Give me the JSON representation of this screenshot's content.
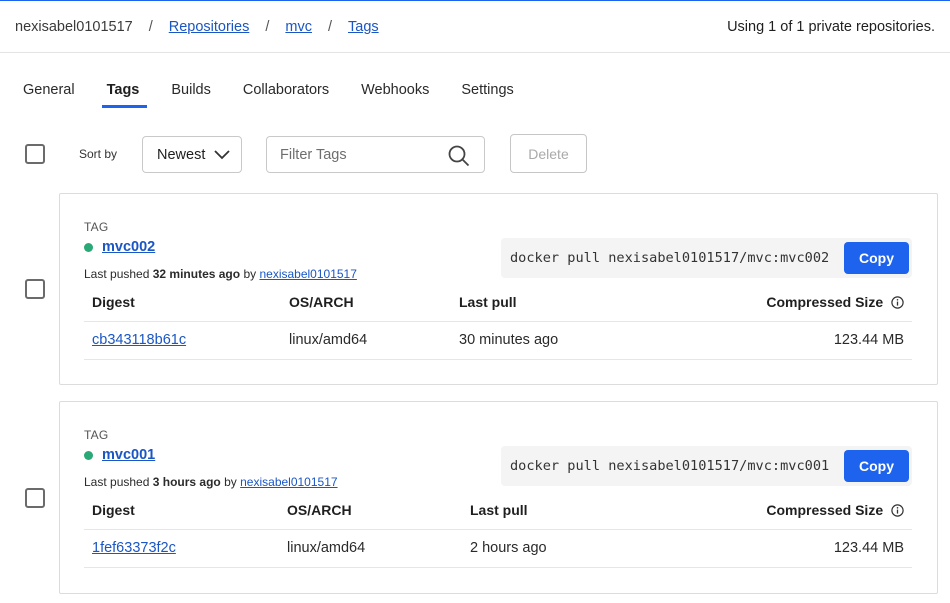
{
  "breadcrumb": {
    "user": "nexisabel0101517",
    "sep": "/",
    "repositories": "Repositories",
    "repo": "mvc",
    "tags": "Tags"
  },
  "usage_text": "Using 1 of 1 private repositories.",
  "tabs": [
    {
      "label": "General"
    },
    {
      "label": "Tags",
      "active": true
    },
    {
      "label": "Builds"
    },
    {
      "label": "Collaborators"
    },
    {
      "label": "Webhooks"
    },
    {
      "label": "Settings"
    }
  ],
  "toolbar": {
    "sort_label": "Sort by",
    "sort_value": "Newest",
    "filter_placeholder": "Filter Tags",
    "delete_label": "Delete"
  },
  "columns": {
    "digest": "Digest",
    "os_arch": "OS/ARCH",
    "last_pull": "Last pull",
    "size": "Compressed Size"
  },
  "tags": [
    {
      "section_label": "TAG",
      "name": "mvc002",
      "pushed_prefix": "Last pushed",
      "pushed_time": "32 minutes ago",
      "pushed_by": "by",
      "pusher": "nexisabel0101517",
      "pull_command": "docker pull nexisabel0101517/mvc:mvc002",
      "copy_label": "Copy",
      "digest": "cb343118b61c",
      "os_arch": "linux/amd64",
      "last_pull": "30 minutes ago",
      "size": "123.44 MB"
    },
    {
      "section_label": "TAG",
      "name": "mvc001",
      "pushed_prefix": "Last pushed",
      "pushed_time": "3 hours ago",
      "pushed_by": "by",
      "pusher": "nexisabel0101517",
      "pull_command": "docker pull nexisabel0101517/mvc:mvc001",
      "copy_label": "Copy",
      "digest": "1fef63373f2c",
      "os_arch": "linux/amd64",
      "last_pull": "2 hours ago",
      "size": "123.44 MB"
    }
  ],
  "icons": {
    "sort": "chevron-down-icon",
    "filter": "search-icon",
    "status": "status-dot-icon",
    "size_info": "info-icon"
  },
  "colors": {
    "accent": "#1d63ed",
    "link": "#1a56c4",
    "status_dot": "#2aa876"
  }
}
